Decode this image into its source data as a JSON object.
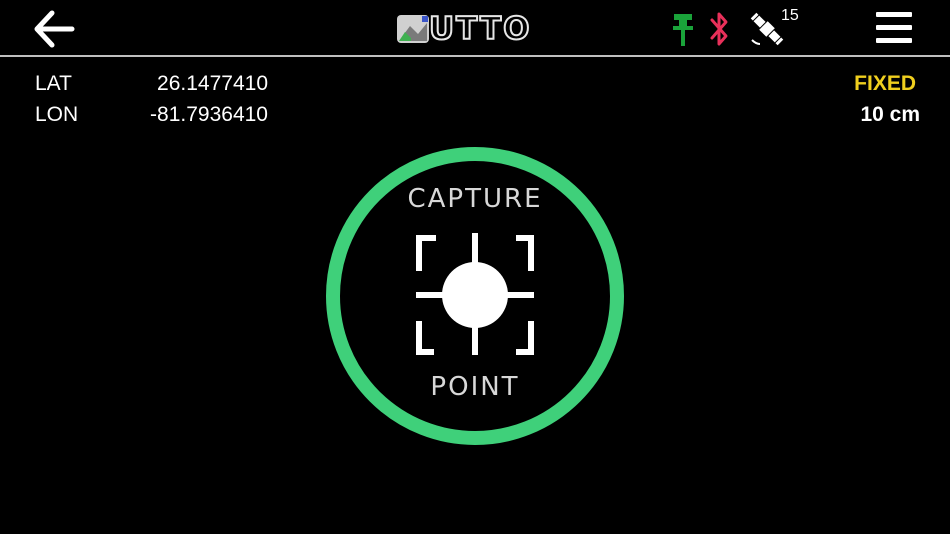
{
  "header": {
    "logo_text": "UTTO",
    "satellite_count": "15",
    "icons": {
      "back": "back-arrow-icon",
      "rover": "rover-icon",
      "bluetooth": "bluetooth-icon",
      "satellite": "satellite-icon",
      "menu": "hamburger-menu-icon"
    }
  },
  "position": {
    "lat_label": "LAT",
    "lat_value": "26.1477410",
    "lon_label": "LON",
    "lon_value": "-81.7936410",
    "fix_status": "FIXED",
    "accuracy": "10 cm"
  },
  "capture": {
    "top_label": "CAPTURE",
    "bottom_label": "POINT"
  },
  "colors": {
    "ring": "#3fd07a",
    "fixed": "#f0cf1e",
    "rover": "#1aa33a",
    "bluetooth": "#e8305a"
  }
}
